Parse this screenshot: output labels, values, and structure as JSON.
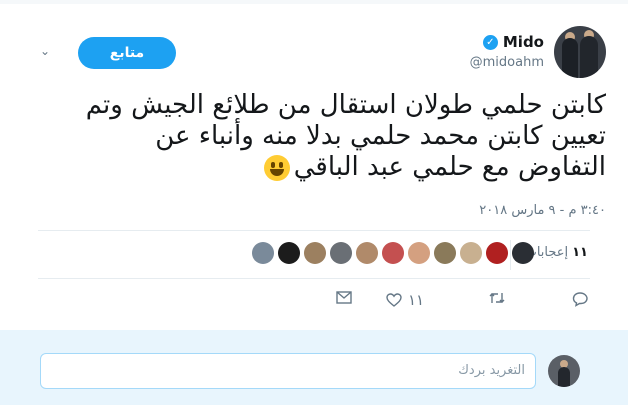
{
  "header": {
    "display_name": "Mido",
    "handle": "@midoahm",
    "follow_label": "متابع",
    "verified_icon": "check-icon"
  },
  "tweet": {
    "line1": "كابتن حلمي طولان استقال من طلائع الجيش وتم",
    "line2": "تعيين كابتن محمد حلمي بدلا منه وأنباء عن",
    "line3": "التفاوض مع حلمي عبد الباقي",
    "emoji": "smiling-face-icon",
    "timestamp": "٣:٤٠ م - ٩ مارس ٢٠١٨"
  },
  "engagement": {
    "likes_count": "١١",
    "likes_label": "إعجابات",
    "face_colors": [
      "#7a8a9a",
      "#1c1c1c",
      "#9c8060",
      "#6a6f75",
      "#b08a6a",
      "#c45050",
      "#d4a080",
      "#8a7a5a",
      "#c8b090",
      "#b02020",
      "#2a2e34"
    ]
  },
  "actions": {
    "reply_icon": "reply-icon",
    "retweet_icon": "retweet-icon",
    "like_icon": "heart-icon",
    "like_count": "١١",
    "dm_icon": "envelope-icon"
  },
  "compose": {
    "placeholder": "التغريد بردك"
  }
}
